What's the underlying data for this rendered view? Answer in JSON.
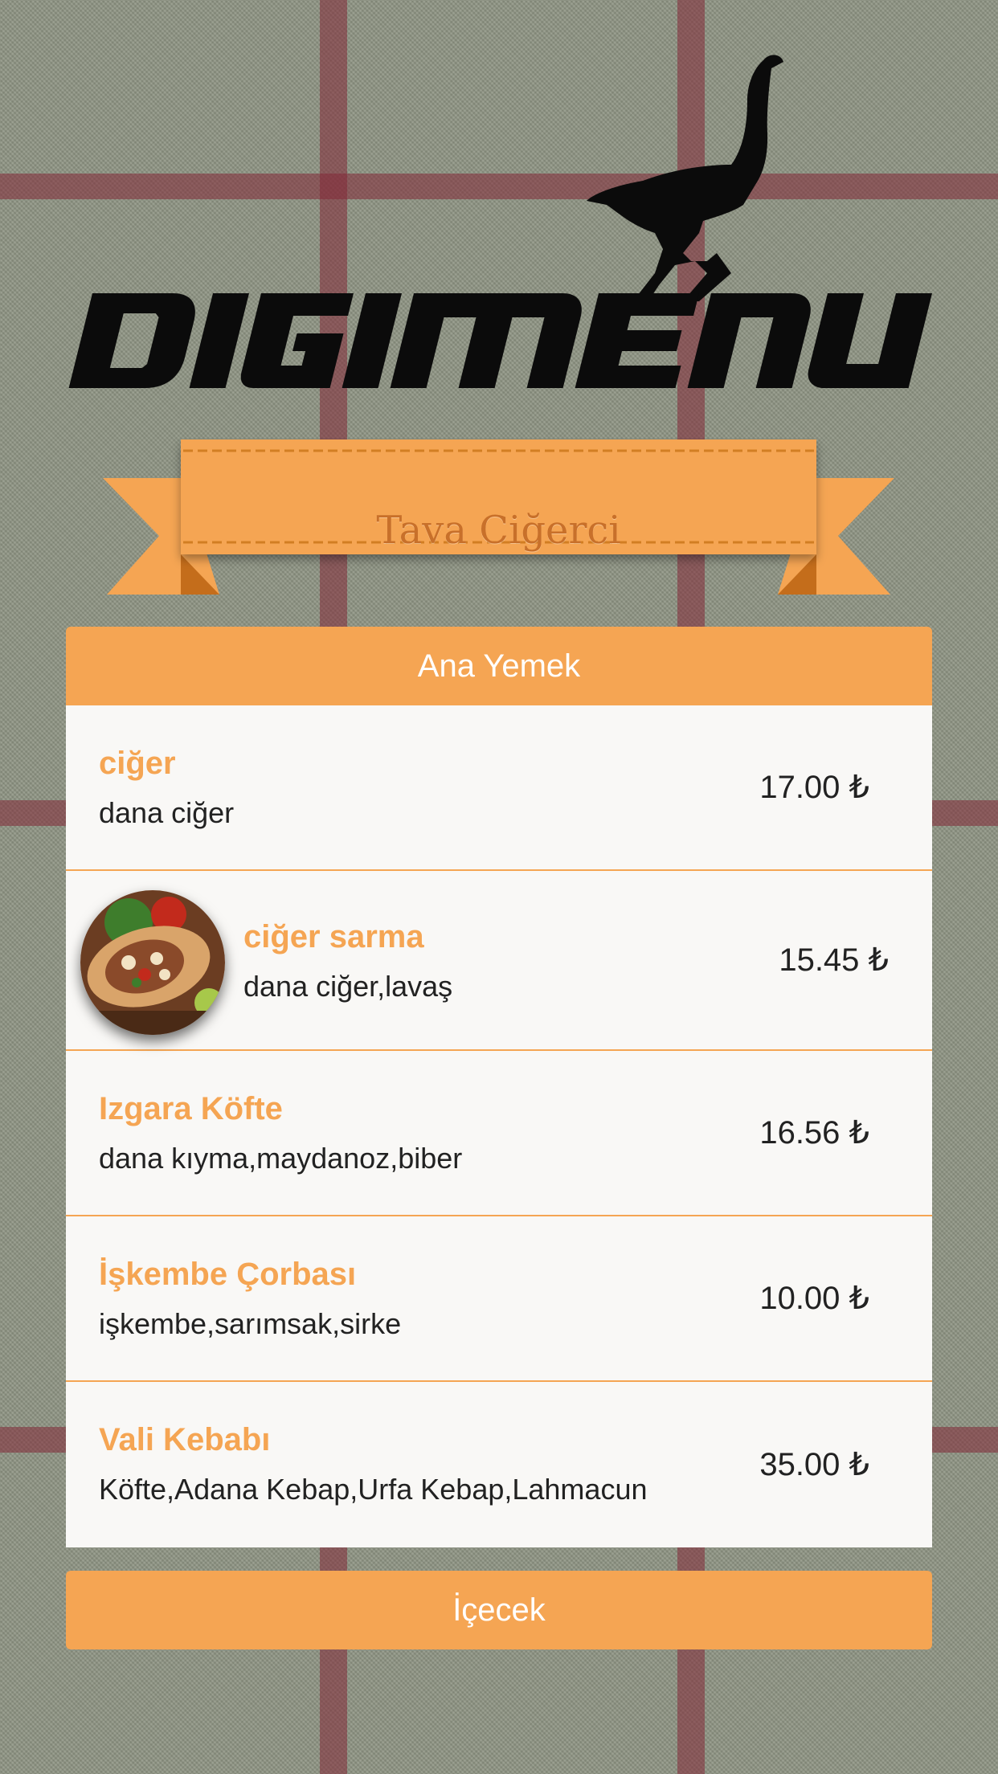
{
  "brand": {
    "logo_text": "DIGIMENU",
    "icon": "ostrich-icon"
  },
  "restaurant": {
    "name": "Tava Ciğerci"
  },
  "colors": {
    "accent": "#f5a553",
    "ribbon_dark": "#d27e23",
    "text": "#222222",
    "panel": "#f9f8f6"
  },
  "sections": [
    {
      "title": "Ana Yemek",
      "items": [
        {
          "name": "ciğer",
          "description": "dana ciğer",
          "price": "17.00 ₺"
        },
        {
          "name": "ciğer sarma",
          "description": "dana ciğer,lavaş",
          "price": "15.45 ₺",
          "photo": "wrap-photo"
        },
        {
          "name": "Izgara Köfte",
          "description": "dana kıyma,maydanoz,biber",
          "price": "16.56 ₺"
        },
        {
          "name": "İşkembe Çorbası",
          "description": "işkembe,sarımsak,sirke",
          "price": "10.00 ₺"
        },
        {
          "name": "Vali Kebabı",
          "description": "Köfte,Adana Kebap,Urfa Kebap,Lahmacun",
          "price": "35.00 ₺"
        }
      ]
    },
    {
      "title": "İçecek",
      "items": []
    }
  ]
}
